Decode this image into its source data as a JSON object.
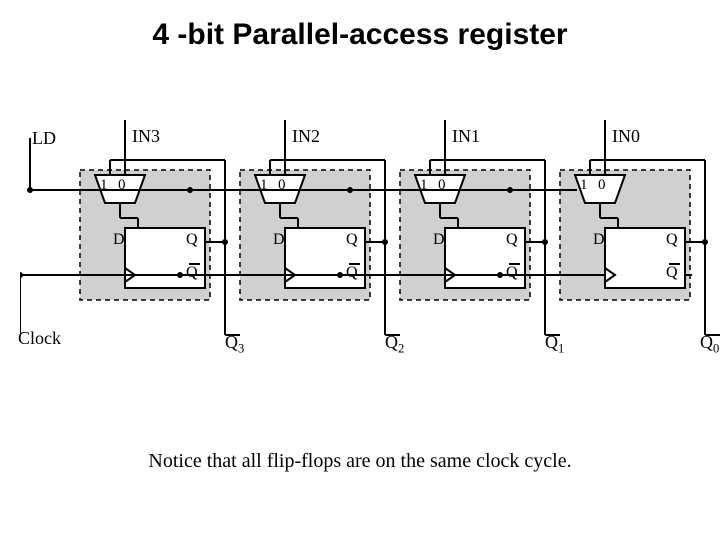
{
  "title": "4 -bit Parallel-access register",
  "note": "Notice that all flip-flops are on the same clock cycle.",
  "LD": "LD",
  "Clock": "Clock",
  "in": [
    "IN3",
    "IN2",
    "IN1",
    "IN0"
  ],
  "out": [
    "Q",
    "Q",
    "Q",
    "Q"
  ],
  "out_sub": [
    "3",
    "2",
    "1",
    "0"
  ],
  "bits": {
    "in_IN3": "IN3",
    "in_IN2": "IN2",
    "in_IN1": "IN1",
    "in_IN0": "IN0",
    "out_Q3": "Q",
    "out_Q2": "Q",
    "out_Q1": "Q",
    "out_Q0": "Q",
    "sub3": "3",
    "sub2": "2",
    "sub1": "1",
    "sub0": "0"
  },
  "mux": {
    "one": "1",
    "zero": "0"
  },
  "ff": {
    "D": "D",
    "Q": "Q",
    "Qbar": "Q"
  }
}
